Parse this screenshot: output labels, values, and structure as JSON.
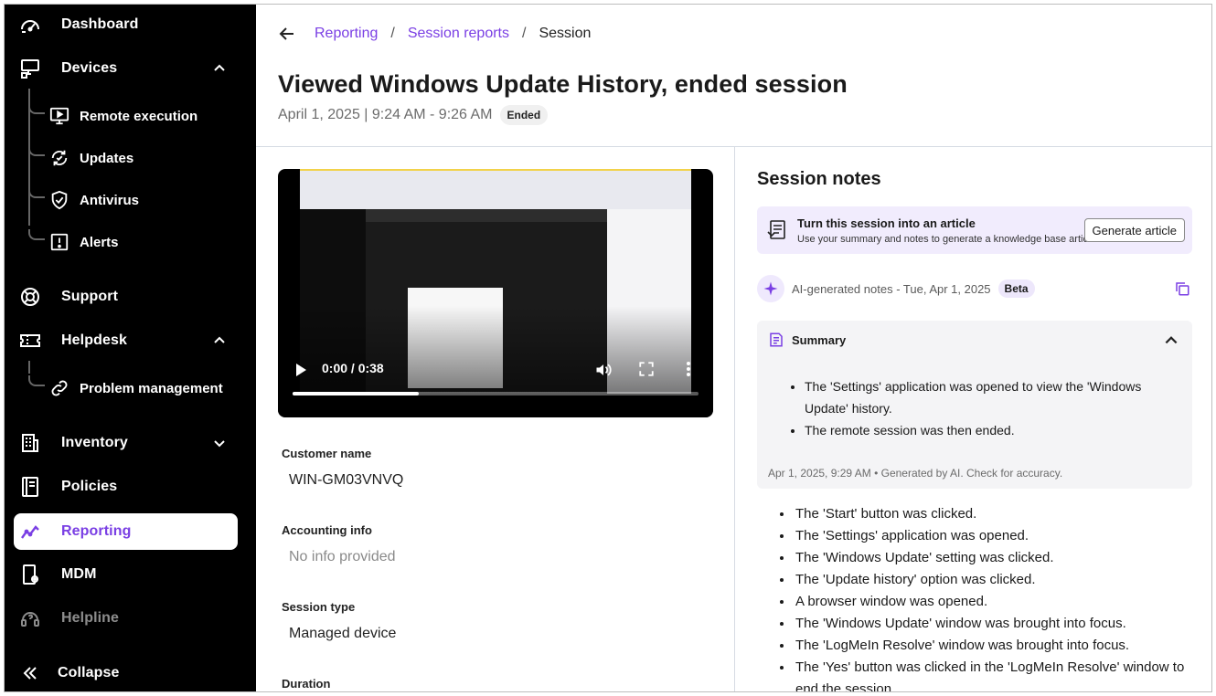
{
  "sidebar": {
    "items": [
      {
        "label": "Dashboard",
        "icon": "dashboard-gauge-icon"
      },
      {
        "label": "Devices",
        "icon": "devices-icon"
      },
      {
        "label": "Support",
        "icon": "lifebuoy-icon"
      },
      {
        "label": "Helpdesk",
        "icon": "ticket-icon"
      },
      {
        "label": "Inventory",
        "icon": "building-icon"
      },
      {
        "label": "Policies",
        "icon": "book-icon"
      },
      {
        "label": "Reporting",
        "icon": "chart-line-icon"
      },
      {
        "label": "MDM",
        "icon": "phone-gear-icon"
      },
      {
        "label": "Helpline",
        "icon": "helpline-icon"
      }
    ],
    "devices_sub": [
      {
        "label": "Remote execution",
        "icon": "monitor-play-icon"
      },
      {
        "label": "Updates",
        "icon": "refresh-check-icon"
      },
      {
        "label": "Antivirus",
        "icon": "shield-check-icon"
      },
      {
        "label": "Alerts",
        "icon": "alert-box-icon"
      }
    ],
    "helpdesk_sub": [
      {
        "label": "Problem management",
        "icon": "link-icon"
      }
    ],
    "collapse_label": "Collapse",
    "active_item": "Reporting",
    "accent_color": "#7a3fe4"
  },
  "breadcrumb": {
    "items": [
      "Reporting",
      "Session reports"
    ],
    "current": "Session"
  },
  "page": {
    "title": "Viewed Windows Update History, ended session",
    "date_range": "April 1, 2025 | 9:24 AM - 9:26 AM",
    "status": "Ended"
  },
  "video": {
    "time": "0:00 / 0:38",
    "progress": 0.31
  },
  "fields": [
    {
      "label": "Customer name",
      "value": "WIN-GM03VNVQ",
      "muted": false
    },
    {
      "label": "Accounting info",
      "value": "No info provided",
      "muted": true
    },
    {
      "label": "Session type",
      "value": "Managed device",
      "muted": false
    },
    {
      "label": "Duration",
      "value": "",
      "muted": false
    }
  ],
  "notes": {
    "title": "Session notes",
    "article": {
      "heading": "Turn this session into an article",
      "description": "Use your summary and notes to generate a knowledge base article.",
      "button": "Generate article"
    },
    "ai_line": "AI-generated notes - Tue, Apr 1, 2025",
    "beta": "Beta",
    "summary": {
      "heading": "Summary",
      "bullets": [
        "The 'Settings' application was opened to view the 'Windows Update' history.",
        "The remote session was then ended."
      ],
      "footer": "Apr 1, 2025, 9:29 AM • Generated by AI. Check for accuracy."
    },
    "items": [
      "The 'Start' button was clicked.",
      "The 'Settings' application was opened.",
      "The 'Windows Update' setting was clicked.",
      "The 'Update history' option was clicked.",
      "A browser window was opened.",
      "The 'Windows Update' window was brought into focus.",
      "The 'LogMeIn Resolve' window was brought into focus.",
      "The 'Yes' button was clicked in the 'LogMeIn Resolve' window to end the session."
    ]
  }
}
